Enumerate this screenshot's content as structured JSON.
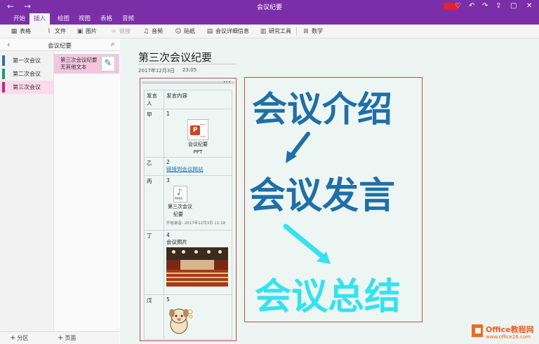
{
  "titlebar": {
    "title": "会议纪要",
    "back": "←",
    "forward": "→",
    "icons": [
      "lightbulb-icon",
      "undo-icon",
      "redo-icon",
      "share-icon",
      "minimize-icon",
      "maximize-icon",
      "close-icon"
    ]
  },
  "tabs": [
    "开始",
    "插入",
    "绘图",
    "视图",
    "表格",
    "音频"
  ],
  "active_tab": "插入",
  "toolbar": {
    "table": "表格",
    "file": "文件",
    "picture": "图片",
    "link": "链接",
    "audio": "音频",
    "sticker": "贴纸",
    "meeting": "会议详细信息",
    "research": "研究工具",
    "math": "数学"
  },
  "notebook": {
    "title": "会议纪要",
    "sections": [
      {
        "label": "第一次会议",
        "color": "#2b6db5"
      },
      {
        "label": "第二次会议",
        "color": "#1f9a6a"
      },
      {
        "label": "第三次会议",
        "color": "#c2297d"
      }
    ],
    "pages": [
      {
        "title": "第三次会议纪要",
        "subtitle": "无其他文本"
      }
    ],
    "add_section": "分区",
    "add_page": "页面"
  },
  "page": {
    "title": "第三次会议纪要",
    "date": "2017年12月3日",
    "time": "23:05"
  },
  "notes_table": {
    "headers": [
      "发言人",
      "发言内容"
    ],
    "rows": [
      {
        "speaker": "甲",
        "num": "1",
        "file_line1": "会议纪要",
        "file_line2": "PPT"
      },
      {
        "speaker": "乙",
        "num": "2",
        "link": "链接到会议网站"
      },
      {
        "speaker": "丙",
        "num": "3",
        "audio_label": "M4A",
        "audio_line1": "第三次会议",
        "audio_line2": "纪要",
        "record_meta": "开始录音: 2017年12月3日 11:18"
      },
      {
        "speaker": "丁",
        "num": "4",
        "caption": "会议照片"
      },
      {
        "speaker": "戊",
        "num": "5"
      }
    ]
  },
  "drawing": {
    "line1": "会议介绍",
    "line2": "会议发言",
    "line3": "会议总结",
    "color_dark": "#1f6fa8",
    "color_light": "#35e2ee"
  },
  "watermark": {
    "line1": "Office教程网",
    "line2": "www.office26.com"
  }
}
